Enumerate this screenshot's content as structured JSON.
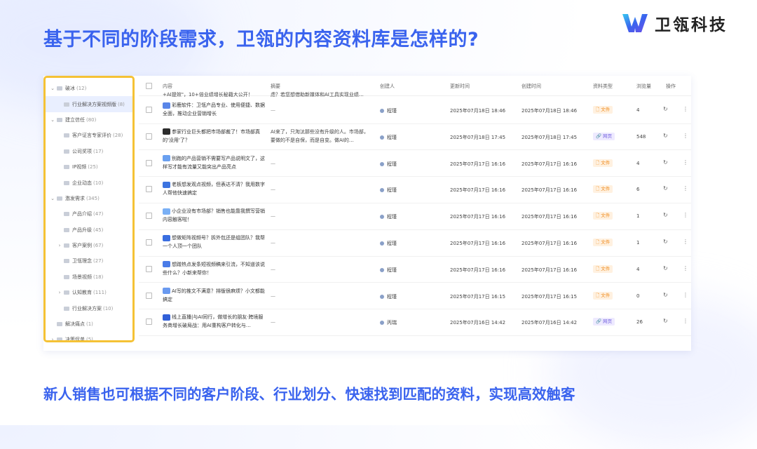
{
  "headline": "基于不同的阶段需求，卫瓴的内容资料库是怎样的?",
  "brand": {
    "name": "卫瓴科技",
    "accent": "#3a63ee",
    "logo_colors": [
      "#38c8f0",
      "#3a63ee",
      "#6d4ee8"
    ]
  },
  "tree": [
    {
      "level": 0,
      "expanded": true,
      "label": "破冰",
      "count": "(12)"
    },
    {
      "level": 1,
      "selected": true,
      "label": "行业解决方案视频版",
      "count": "(8)"
    },
    {
      "level": 0,
      "expanded": true,
      "label": "建立信任",
      "count": "(80)"
    },
    {
      "level": 1,
      "label": "客户证言专家评价",
      "count": "(28)"
    },
    {
      "level": 1,
      "label": "公司奖项",
      "count": "(17)"
    },
    {
      "level": 1,
      "label": "IP视频",
      "count": "(25)"
    },
    {
      "level": 1,
      "label": "企业动态",
      "count": "(10)"
    },
    {
      "level": 0,
      "expanded": true,
      "label": "激发需求",
      "count": "(345)"
    },
    {
      "level": 1,
      "label": "产品介绍",
      "count": "(47)"
    },
    {
      "level": 1,
      "label": "产品升级",
      "count": "(45)"
    },
    {
      "level": 1,
      "expandable": true,
      "label": "客户案例",
      "count": "(67)"
    },
    {
      "level": 1,
      "label": "卫瓴理念",
      "count": "(27)"
    },
    {
      "level": 1,
      "label": "场景视频",
      "count": "(18)"
    },
    {
      "level": 1,
      "expandable": true,
      "label": "认知教育",
      "count": "(111)"
    },
    {
      "level": 1,
      "label": "行业解决方案",
      "count": "(10)"
    },
    {
      "level": 0,
      "label": "解决痛点",
      "count": "(1)"
    },
    {
      "level": 0,
      "expandable": true,
      "label": "决策促单",
      "count": "(5)"
    }
  ],
  "table": {
    "headers": {
      "content": "内容",
      "summary": "摘要",
      "creator": "创建人",
      "updated": "更新时间",
      "created": "创建时间",
      "type": "资料类型",
      "views": "浏览量",
      "actions": "操作"
    },
    "partial_row": {
      "content": "+AI提效\"，10+倍业绩增长秘籍大公开！",
      "summary": "虑？若您想借助新媒体和AI工具实现业绩…"
    },
    "rows": [
      {
        "content": "彩鹿软件：卫瓴产品专业、使用便捷、数据全面，推动企业营销增长",
        "thumb": "#5a86e8",
        "summary": "—",
        "creator": "程瑾",
        "updated": "2025年07月18日 18:46",
        "created": "2025年07月18日 18:46",
        "type": "文件",
        "type_kind": "file",
        "views": "4"
      },
      {
        "content": "参家行业巨头都把市场部裁了！市场部真的'没用'了？",
        "thumb": "#2c2c2c",
        "summary": "AI来了，只淘汰那些没有升级的人。市场部，要做的不是自保，而是自变。做AI的…",
        "creator": "程瑾",
        "updated": "2025年07月18日 17:45",
        "created": "2025年07月18日 17:45",
        "type": "网页",
        "type_kind": "web",
        "views": "548"
      },
      {
        "content": "别跑的产品营销不需要写产品说明文了，这样写才能有流量又能突出产品亮点",
        "thumb": "#6aa0f0",
        "summary": "—",
        "creator": "程瑾",
        "updated": "2025年07月17日 16:16",
        "created": "2025年07月17日 16:16",
        "type": "文件",
        "type_kind": "file",
        "views": "4"
      },
      {
        "content": "老板想发观点视频，但表达不清？我用数字人帮他快速搞定",
        "thumb": "#3d74e0",
        "summary": "—",
        "creator": "程瑾",
        "updated": "2025年07月17日 16:16",
        "created": "2025年07月17日 16:16",
        "type": "文件",
        "type_kind": "file",
        "views": "6"
      },
      {
        "content": "小企业没有市场部？销售也能靠我撰写营销内容触客啦！",
        "thumb": "#7ab0f5",
        "summary": "—",
        "creator": "程瑾",
        "updated": "2025年07月17日 16:16",
        "created": "2025年07月17日 16:16",
        "type": "文件",
        "type_kind": "file",
        "views": "1"
      },
      {
        "content": "想做矩阵视频号？拆外包还是组团队？我帮一个人顶一个团队",
        "thumb": "#3a6ee0",
        "summary": "—",
        "creator": "程瑾",
        "updated": "2025年07月17日 16:16",
        "created": "2025年07月17日 16:16",
        "type": "文件",
        "type_kind": "file",
        "views": "1"
      },
      {
        "content": "想蹭热点发条短视频稿来引流，不知道该说些什么？小新来帮你！",
        "thumb": "#4a7ce8",
        "summary": "—",
        "creator": "程瑾",
        "updated": "2025年07月17日 16:16",
        "created": "2025年07月17日 16:16",
        "type": "文件",
        "type_kind": "file",
        "views": "4"
      },
      {
        "content": "AI写的推文不满意？排版很麻烦？小文都能搞定",
        "thumb": "#6a9af0",
        "summary": "—",
        "creator": "程瑾",
        "updated": "2025年07月17日 16:15",
        "created": "2025年07月17日 16:15",
        "type": "文件",
        "type_kind": "file",
        "views": "0"
      },
      {
        "content": "线上直播|与AI同行，做增长的朋友·跨境服务商增长破局战：用AI重构客户转化与…",
        "thumb": "#3260d8",
        "summary": "—",
        "creator": "丙瑞",
        "updated": "2025年07月16日 14:42",
        "created": "2025年07月16日 14:42",
        "type": "网页",
        "type_kind": "web",
        "views": "26"
      }
    ]
  },
  "footer_text": "新人销售也可根据不同的客户阶段、行业划分、快速找到匹配的资料，实现高效触客"
}
